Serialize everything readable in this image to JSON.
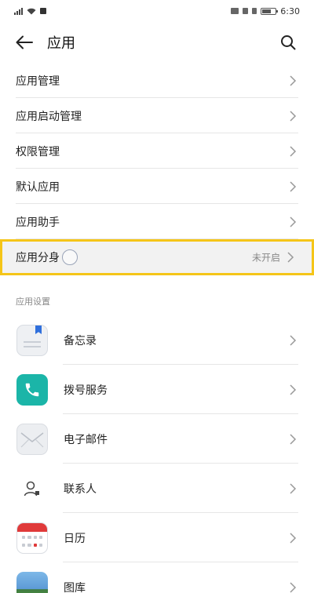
{
  "status_bar": {
    "time": "6:30"
  },
  "header": {
    "title": "应用",
    "back_icon": "arrow-left-icon",
    "search_icon": "search-icon"
  },
  "menu": {
    "items": [
      {
        "label": "应用管理"
      },
      {
        "label": "应用启动管理"
      },
      {
        "label": "权限管理"
      },
      {
        "label": "默认应用"
      },
      {
        "label": "应用助手"
      },
      {
        "label": "应用分身",
        "value": "未开启"
      }
    ]
  },
  "section": {
    "title": "应用设置"
  },
  "apps": [
    {
      "label": "备忘录",
      "icon": "notes-icon"
    },
    {
      "label": "拨号服务",
      "icon": "phone-icon"
    },
    {
      "label": "电子邮件",
      "icon": "mail-icon"
    },
    {
      "label": "联系人",
      "icon": "contacts-icon"
    },
    {
      "label": "日历",
      "icon": "calendar-icon"
    },
    {
      "label": "图库",
      "icon": "gallery-icon"
    }
  ],
  "colors": {
    "highlight_border": "#f5c518",
    "phone_icon": "#1bb5a8",
    "calendar_red": "#e03a3a",
    "notes_bookmark": "#2f6fdc"
  }
}
